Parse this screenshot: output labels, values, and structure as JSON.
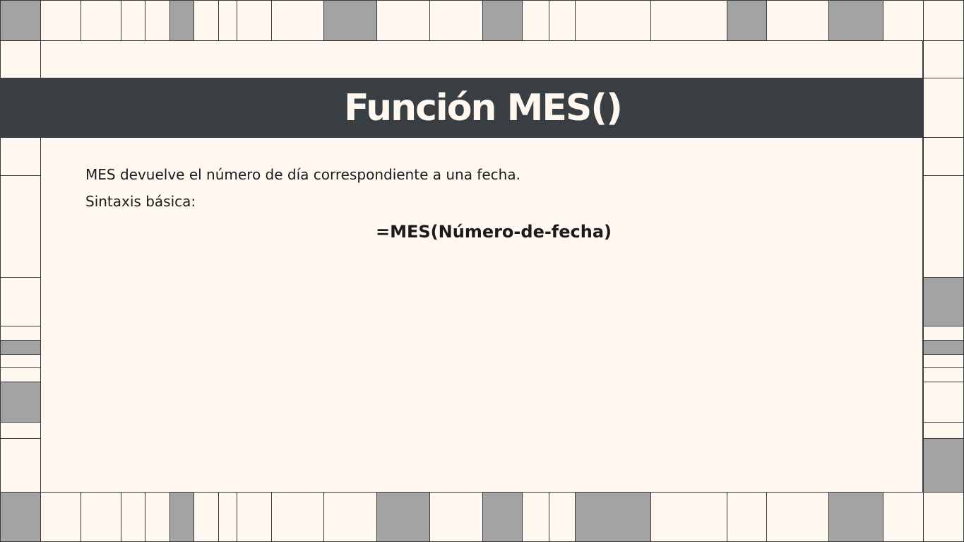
{
  "slide": {
    "title": "Función MES()",
    "description": "MES devuelve el número de día correspondiente a una fecha.",
    "syntax_label": "Sintaxis básica:",
    "formula": "=MES(Número-de-fecha)"
  },
  "colors": {
    "background": "#fff8f1",
    "title_band": "#383e42",
    "title_text": "#fff8f1",
    "tile_gray": "#a3a3a3",
    "line": "#3a3a3a",
    "body_text": "#1a1a1a"
  }
}
